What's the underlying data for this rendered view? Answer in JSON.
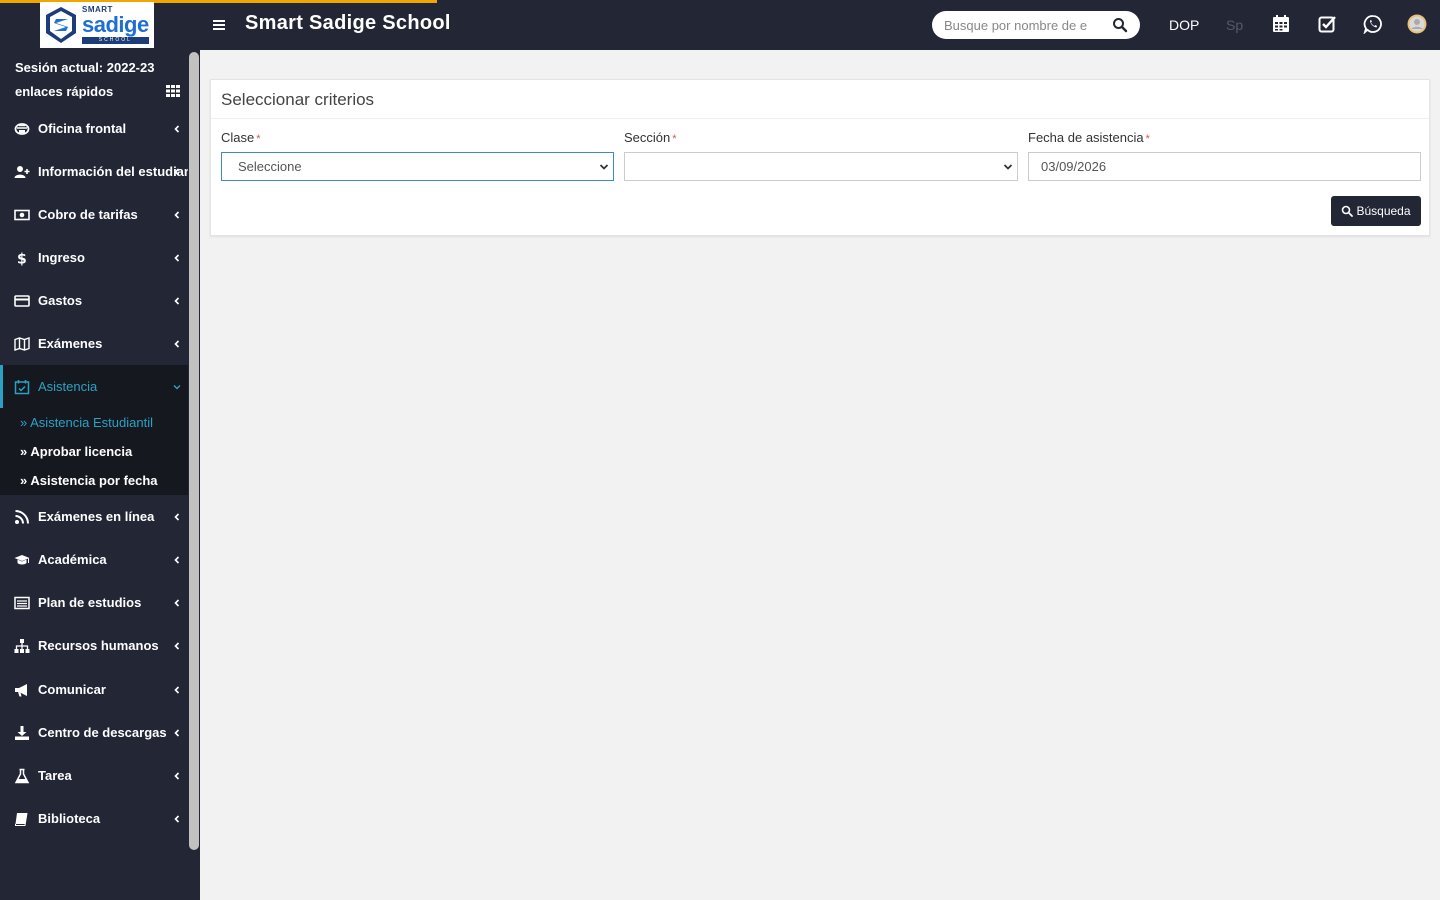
{
  "header": {
    "logo": {
      "smart": "SMART",
      "sadige": "sadige",
      "school": "SCHOOL"
    },
    "title": "Smart Sadige School",
    "search_placeholder": "Busque por nombre de e",
    "currency": "DOP",
    "language": "Sp",
    "icons": [
      "calendar-icon",
      "check-square-icon",
      "whatsapp-icon",
      "avatar"
    ]
  },
  "sidebar": {
    "session": "Sesión actual: 2022-23",
    "quick_links": "enlaces rápidos",
    "items": [
      {
        "label": "Oficina frontal",
        "icon": "front-office-icon"
      },
      {
        "label": "Información del estudiante",
        "icon": "user-plus-icon"
      },
      {
        "label": "Cobro de tarifas",
        "icon": "money-icon"
      },
      {
        "label": "Ingreso",
        "icon": "dollar-icon"
      },
      {
        "label": "Gastos",
        "icon": "credit-card-icon"
      },
      {
        "label": "Exámenes",
        "icon": "map-icon"
      },
      {
        "label": "Asistencia",
        "icon": "calendar-check-icon",
        "active": true
      },
      {
        "label": "Exámenes en línea",
        "icon": "rss-icon"
      },
      {
        "label": "Académica",
        "icon": "graduation-cap-icon"
      },
      {
        "label": "Plan de estudios",
        "icon": "list-alt-icon"
      },
      {
        "label": "Recursos humanos",
        "icon": "sitemap-icon"
      },
      {
        "label": "Comunicar",
        "icon": "bullhorn-icon"
      },
      {
        "label": "Centro de descargas",
        "icon": "download-icon"
      },
      {
        "label": "Tarea",
        "icon": "flask-icon"
      },
      {
        "label": "Biblioteca",
        "icon": "book-icon"
      }
    ],
    "submenu": [
      {
        "label": "Asistencia Estudiantil",
        "active": true
      },
      {
        "label": "Aprobar licencia"
      },
      {
        "label": "Asistencia por fecha"
      }
    ]
  },
  "main": {
    "panel_title": "Seleccionar criterios",
    "fields": {
      "class": {
        "label": "Clase",
        "required": "*",
        "value": "Seleccione"
      },
      "section": {
        "label": "Sección",
        "required": "*",
        "value": ""
      },
      "date": {
        "label": "Fecha de asistencia",
        "required": "*",
        "value": "03/09/2026"
      }
    },
    "search_button": "Búsqueda"
  },
  "colors": {
    "topbar": "#232635",
    "accent": "#2aa1c5",
    "progress": "#f0a500",
    "required": "#d9534f"
  }
}
